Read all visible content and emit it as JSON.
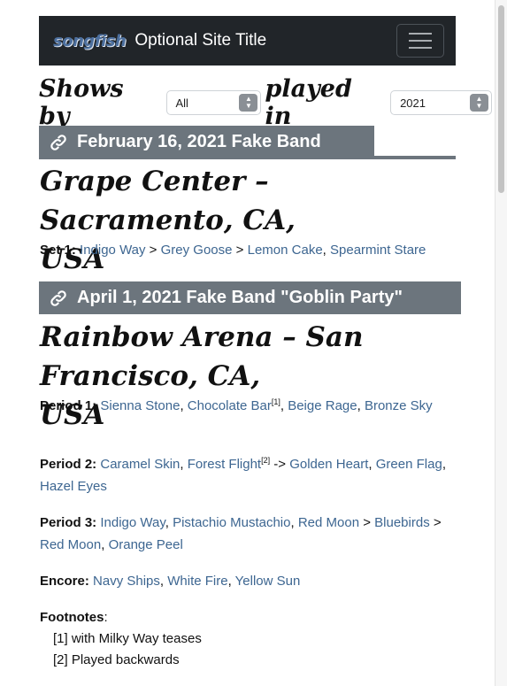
{
  "navbar": {
    "logo": "songfish",
    "site_title": "Optional Site Title"
  },
  "filter": {
    "shows_by": "Shows by",
    "band_selected": "All",
    "played_in": "played in",
    "year_selected": "2021"
  },
  "shows": [
    {
      "header": "February 16, 2021 Fake Band",
      "venue": "Grape Center – Sacramento, CA, USA",
      "venue_line1": "Grape Center – Sacramento, CA,",
      "venue_line2": "USA",
      "sets": [
        {
          "label": "Set 1:",
          "songs": [
            "Indigo Way",
            "Grey Goose",
            "Lemon Cake",
            "Spearmint Stare"
          ],
          "separators": [
            " > ",
            " > ",
            ", "
          ]
        }
      ]
    },
    {
      "header": "April 1, 2021 Fake Band \"Goblin Party\"",
      "venue_line1": "Rainbow Arena – San Francisco, CA,",
      "venue_line2": "USA",
      "sets": [
        {
          "label": "Period 1:",
          "songs": [
            "Sienna Stone",
            "Chocolate Bar",
            "Beige Rage",
            "Bronze Sky"
          ],
          "footnote_marks": [
            "",
            "[1]",
            "",
            ""
          ],
          "separators": [
            ", ",
            ", ",
            ", "
          ]
        },
        {
          "label": "Period 2:",
          "songs": [
            "Caramel Skin",
            "Forest Flight",
            "Golden Heart",
            "Green Flag",
            "Hazel Eyes"
          ],
          "footnote_marks": [
            "",
            "[2]",
            "",
            "",
            ""
          ],
          "separators": [
            ", ",
            " -> ",
            ", ",
            ", "
          ]
        },
        {
          "label": "Period 3:",
          "songs": [
            "Indigo Way",
            "Pistachio Mustachio",
            "Red Moon",
            "Bluebirds",
            "Red Moon",
            "Orange Peel"
          ],
          "separators": [
            ", ",
            ", ",
            " > ",
            " > ",
            ", "
          ]
        },
        {
          "label": "Encore:",
          "songs": [
            "Navy Ships",
            "White Fire",
            "Yellow Sun"
          ],
          "separators": [
            ", ",
            ", "
          ]
        }
      ],
      "footnotes_label": "Footnotes",
      "footnotes": [
        "[1] with Milky Way teases",
        "[2] Played backwards"
      ]
    }
  ]
}
